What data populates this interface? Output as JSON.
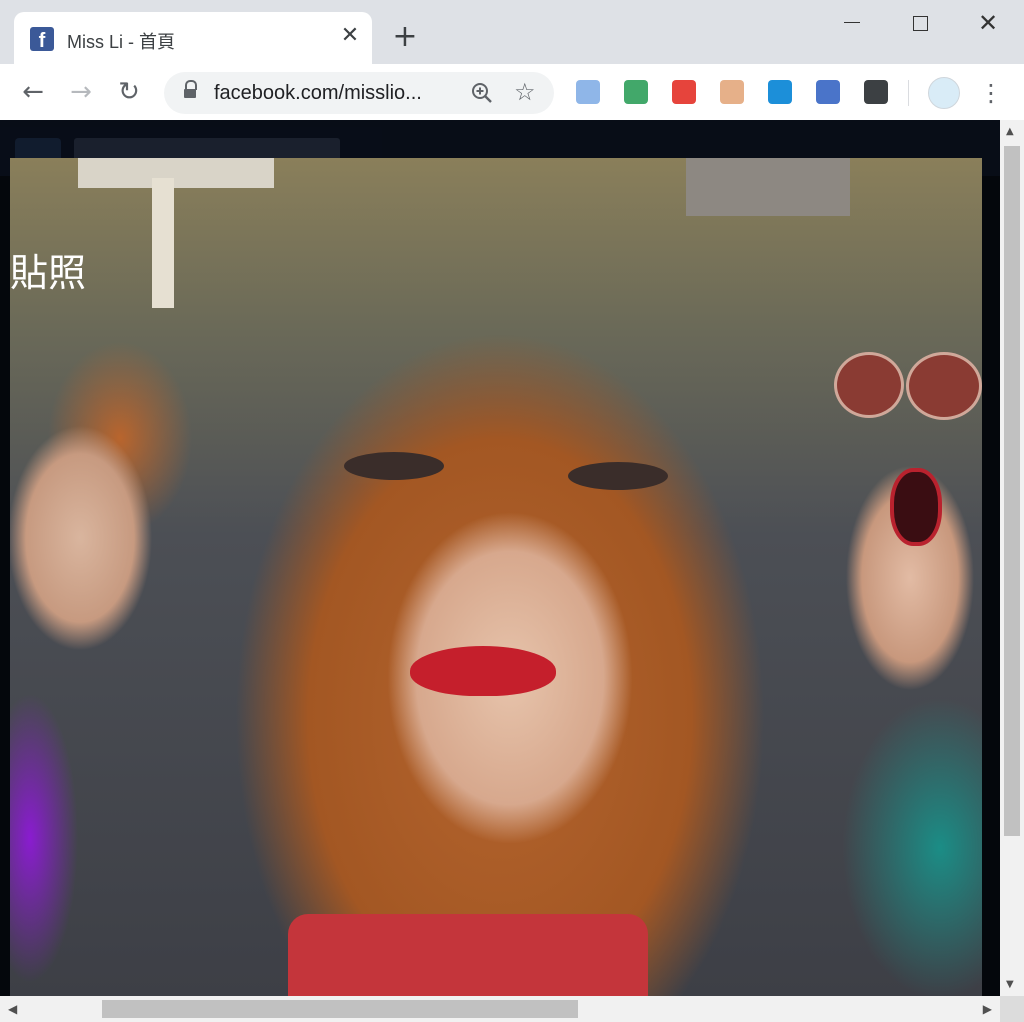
{
  "browser": {
    "tab": {
      "title": "Miss Li - 首頁",
      "favicon": "facebook-f-icon",
      "favicon_glyph": "f",
      "close_glyph": "✕"
    },
    "new_tab_glyph": "+",
    "window_controls": {
      "minimize": "minimize-icon",
      "maximize": "maximize-icon",
      "close_glyph": "✕"
    },
    "toolbar": {
      "back_glyph": "←",
      "forward_glyph": "→",
      "reload_glyph": "↻",
      "url": "facebook.com/misslio...",
      "star_glyph": "☆",
      "menu_glyph": "⋮"
    },
    "extensions": [
      {
        "name": "notes-extension-icon",
        "color": "#8fb6e8"
      },
      {
        "name": "mail-check-extension-icon",
        "color": "#42a86a"
      },
      {
        "name": "shield-extension-icon",
        "color": "#e6443c"
      },
      {
        "name": "cat-extension-icon",
        "color": "#e6b089"
      },
      {
        "name": "share-extension-icon",
        "color": "#1c8fd9"
      },
      {
        "name": "owl-extension-icon",
        "color": "#4a74c9"
      },
      {
        "name": "screenshot-extension-icon",
        "color": "#3c4043"
      }
    ]
  },
  "page": {
    "overlay_text": "貼照",
    "scroll_up": "▲",
    "scroll_down": "▼",
    "scroll_left": "◀",
    "scroll_right": "▶"
  },
  "colors": {
    "tab_strip": "#dee1e6",
    "toolbar": "#ffffff",
    "lip_red": "#c51f2c",
    "hair": "#b4642e"
  }
}
